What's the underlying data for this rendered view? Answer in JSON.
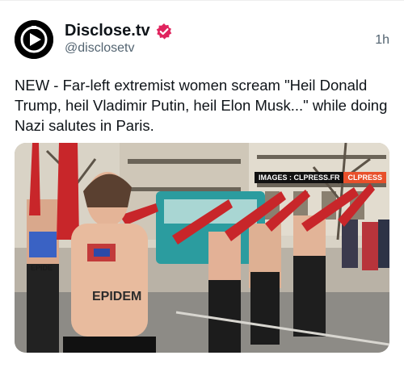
{
  "post": {
    "author_name": "Disclose.tv",
    "author_handle": "@disclosetv",
    "time": "1h",
    "verified_icon": "verified-badge-icon",
    "text": "NEW - Far-left extremist women scream \"Heil Donald Trump, heil Vladimir Putin, heil Elon Musk...\" while doing Nazi salutes in Paris."
  },
  "media": {
    "watermark_left": "IMAGES : CLPRESS.FR",
    "watermark_right": "CLPRESS",
    "body_paint_left": "EPIDE",
    "body_paint_center": "EPIDEM"
  },
  "colors": {
    "verified": "#e0245e",
    "glove_red": "#c8262a",
    "watermark_orange": "#e8502b"
  }
}
